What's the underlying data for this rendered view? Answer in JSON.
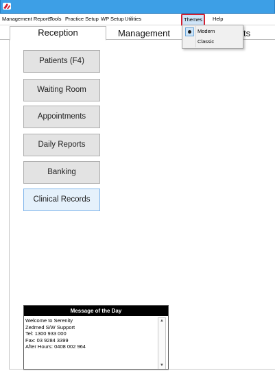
{
  "menubar": {
    "items": [
      "Management Reports",
      "Tools",
      "Practice Setup",
      "WP Setup",
      "Utilities",
      "Themes",
      "Help"
    ]
  },
  "tabs": [
    "Reception",
    "Management",
    "ts"
  ],
  "themes_menu": {
    "items": [
      {
        "label": "Modern",
        "checked": true
      },
      {
        "label": "Classic",
        "checked": false
      }
    ]
  },
  "nav_buttons": [
    "Patients (F4)",
    "Waiting Room",
    "Appointments",
    "Daily Reports",
    "Banking",
    "Clinical Records"
  ],
  "motd": {
    "title": "Message of the Day",
    "lines": [
      "Welcome to Serenity",
      "Zedmed S/W Support",
      "Tel:  1300 933 000",
      "Fax:  03 9284 3399",
      "After Hours: 0408 002 964"
    ]
  },
  "colors": {
    "titlebar": "#3d9fe6",
    "highlight": "#d42030"
  }
}
